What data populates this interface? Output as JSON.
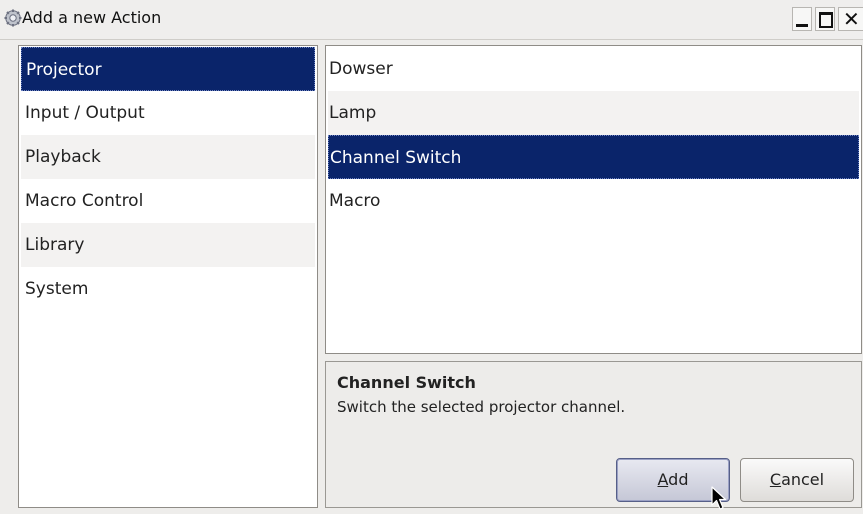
{
  "window": {
    "title": "Add a new Action",
    "icon": "gear-icon"
  },
  "categories": [
    {
      "label": "Projector",
      "selected": true
    },
    {
      "label": "Input / Output",
      "selected": false
    },
    {
      "label": "Playback",
      "selected": false
    },
    {
      "label": "Macro Control",
      "selected": false
    },
    {
      "label": "Library",
      "selected": false
    },
    {
      "label": "System",
      "selected": false
    }
  ],
  "actions": [
    {
      "label": "Dowser",
      "selected": false
    },
    {
      "label": "Lamp",
      "selected": false
    },
    {
      "label": "Channel Switch",
      "selected": true
    },
    {
      "label": "Macro",
      "selected": false
    }
  ],
  "description": {
    "title": "Channel Switch",
    "text": "Switch the selected projector channel."
  },
  "buttons": {
    "add_mnemonic": "A",
    "add_rest": "dd",
    "cancel_mnemonic": "C",
    "cancel_rest": "ancel"
  },
  "colors": {
    "selection": "#0a246a",
    "selection_text": "#ffffff"
  }
}
